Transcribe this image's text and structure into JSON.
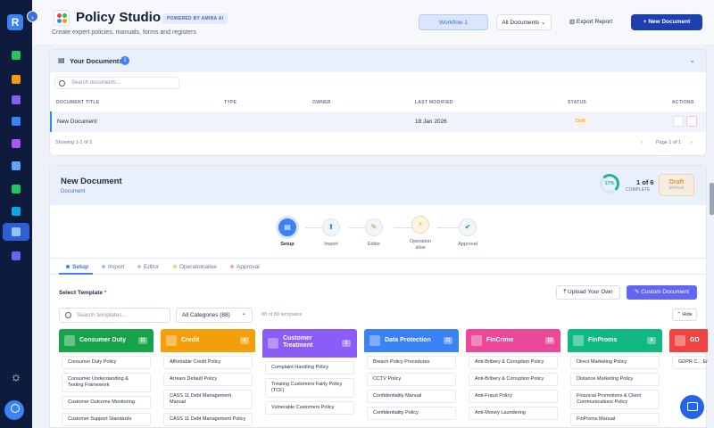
{
  "app": {
    "title": "Policy Studio",
    "powered": "POWERED BY AMINA AI",
    "subtitle": "Create expert policies, manuals, forms and registers",
    "collapse_glyph": "›",
    "rail_logo": "R"
  },
  "header": {
    "workflow_btn": "Workflow 1",
    "filter_select": "All Documents",
    "export_btn": "Export Report",
    "new_btn": "+ New Document"
  },
  "your_documents": {
    "title": "Your Documents",
    "count": "1",
    "search_placeholder": "Search documents...",
    "columns": [
      "DOCUMENT TITLE",
      "TYPE",
      "OWNER",
      "LAST MODIFIED",
      "STATUS",
      "ACTIONS"
    ],
    "rows": [
      {
        "title": "New Document",
        "type": "",
        "owner": "",
        "modified": "18 Jan 2026",
        "status": "Draft"
      }
    ],
    "footer_left": "Showing 1-1 of 1",
    "pagination": "Page 1 of 1"
  },
  "new_document": {
    "title": "New Document",
    "type": "Document",
    "progress_pct": "17%",
    "progress_value": 17,
    "progress_of": "1 of 6",
    "progress_label": "COMPLETE",
    "status_value": "Draft",
    "status_label": "STATUS",
    "steps": [
      "Setup",
      "Import",
      "Editor",
      "Operationalise",
      "Approval"
    ],
    "tabs": [
      "Setup",
      "Import",
      "Editor",
      "Operationalise",
      "Approval"
    ],
    "select_template": "Select Template",
    "upload_btn": "Upload Your Own",
    "custom_btn": "Custom Document",
    "template_search_placeholder": "Search templates...",
    "category_select": "All Categories (88)",
    "template_count": "88 of 88 templates",
    "hide_btn": "Hide"
  },
  "categories": [
    {
      "name": "Consumer Duty",
      "count": "11",
      "color": "#16a34a",
      "items": [
        "Consumer Duty Policy",
        "Consumer Understanding & Testing Framework",
        "Customer Outcome Monitoring",
        "Customer Support Standards"
      ]
    },
    {
      "name": "Credit",
      "count": "4",
      "color": "#f59e0b",
      "items": [
        "Affordable Credit Policy",
        "Arrears Default Policy",
        "CASS 11 Debt Management Manual",
        "CASS 11 Debt Management Policy"
      ]
    },
    {
      "name": "Customer Treatment",
      "count": "3",
      "color": "#8b5cf6",
      "items": [
        "Complaint Handling Policy",
        "Treating Customers Fairly Policy (TCF)",
        "Vulnerable Customers Policy"
      ]
    },
    {
      "name": "Data Protection",
      "count": "11",
      "color": "#3b82f6",
      "items": [
        "Breach Policy Procedures",
        "CCTV Policy",
        "Confidentiality Manual",
        "Confidentiality Policy"
      ]
    },
    {
      "name": "FinCrime",
      "count": "13",
      "color": "#ec4899",
      "items": [
        "Anti-Bribery & Corruption Policy",
        "Anti-Bribery & Corruption Policy",
        "Anti-Fraud Policy",
        "Anti-Money Laundering"
      ]
    },
    {
      "name": "FinProms",
      "count": "4",
      "color": "#10b981",
      "items": [
        "Direct Marketing Policy",
        "Distance Marketing Policy",
        "Financial Promotions & Client Communications Policy",
        "FinProms Manual"
      ]
    },
    {
      "name": "GD",
      "count": "",
      "color": "#ef4444",
      "items": [
        "GDPR C... Employe..."
      ]
    }
  ],
  "colors": {
    "accent": "#3b82f6",
    "navy": "#0f1b3d",
    "draft": "#e89a2c",
    "progress": "#20b39a"
  }
}
